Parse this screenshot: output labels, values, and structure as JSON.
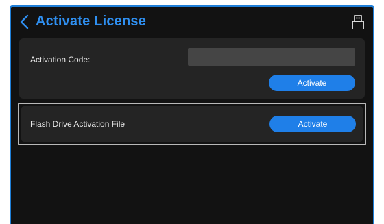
{
  "header": {
    "title": "Activate License",
    "back_icon": "chevron-left-icon",
    "device_icon": "usb-drive-icon"
  },
  "activation_code": {
    "label": "Activation Code:",
    "input_value": "",
    "button_label": "Activate"
  },
  "flash_drive": {
    "label": "Flash Drive Activation File",
    "button_label": "Activate"
  },
  "colors": {
    "accent": "#1f7fe8",
    "title": "#2f8ff0",
    "background": "#121212",
    "panel": "#242424",
    "input": "#454545",
    "focus_border": "#b8b8b8"
  }
}
